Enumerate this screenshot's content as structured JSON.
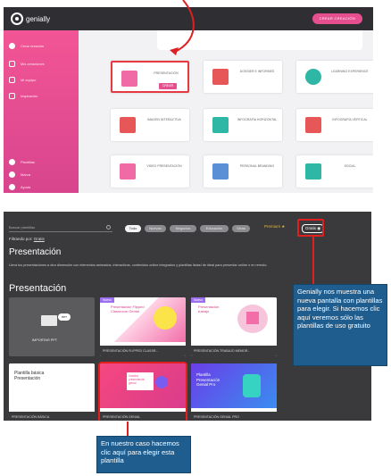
{
  "panel1": {
    "logo_text": "genially",
    "create_button": "CREAR CREACIÓN",
    "sidebar": [
      {
        "label": "Crear creación"
      },
      {
        "label": "Mis creaciones"
      },
      {
        "label": "Mi equipo"
      },
      {
        "label": "Inspiración"
      },
      {
        "label": "Plantillas"
      },
      {
        "label": "Marca"
      },
      {
        "label": "Ayuda"
      }
    ],
    "tiles": [
      {
        "label": "PRESENTACIÓN",
        "action": "CREAR"
      },
      {
        "label": "DOSSIER E INFORMES"
      },
      {
        "label": "LEARNING EXPERIENCE"
      },
      {
        "label": "IMAGEN INTERACTIVA"
      },
      {
        "label": "INFOGRAFÍA HORIZONTAL"
      },
      {
        "label": "INFOGRAFÍA VERTICAL"
      },
      {
        "label": "VIDEO PRESENTACIÓN"
      },
      {
        "label": "PERSONAL BRANDING"
      },
      {
        "label": "SOCIAL"
      }
    ]
  },
  "panel2": {
    "search_placeholder": "Buscar plantillas",
    "chips": [
      "Todo",
      "Nuevas",
      "Negocios",
      "Educación",
      "Otras"
    ],
    "premium_label": "Premium",
    "gratis_label": "Gratis",
    "filter_prefix": "Filtrando por:",
    "filter_value": "Gratis",
    "page_title": "Presentación",
    "description": "Lleva tus presentaciones a otra dimensión con elementos animados, interactivos, contenidos online integrados y plantillas listas! de ideal para presentar online o en remoto.",
    "section_title": "Presentación",
    "badge_new": "Nuevo",
    "cards": [
      {
        "caption": "IMPORTAR PPT",
        "title": ""
      },
      {
        "caption": "PRESENTACIÓN FLIPPED CLASSR...",
        "title": "Presentación Flipped Classroom Genial"
      },
      {
        "caption": "PRESENTACIÓN TRABAJO MEMOR...",
        "title": "Presentación trabajo"
      },
      {
        "caption": "PRESENTACIÓN BÁSICA",
        "title": "Plantilla básica Presentación"
      },
      {
        "caption": "PRESENTACIÓN GENIAL",
        "title": "Vuestra presentación genial"
      },
      {
        "caption": "PRESENTACIÓN GENIAL PRO",
        "title": "Plantilla Presentación Genial Pro"
      }
    ]
  },
  "callouts": {
    "right": "Genially nos muestra una nueva pantalla con plantillas para elegir. Si hacemos clic aquí veremos sólo las plantillas de uso gratuito",
    "bottom": "En nuestro caso hacemos clic aquí para elegir esta plantilla"
  }
}
